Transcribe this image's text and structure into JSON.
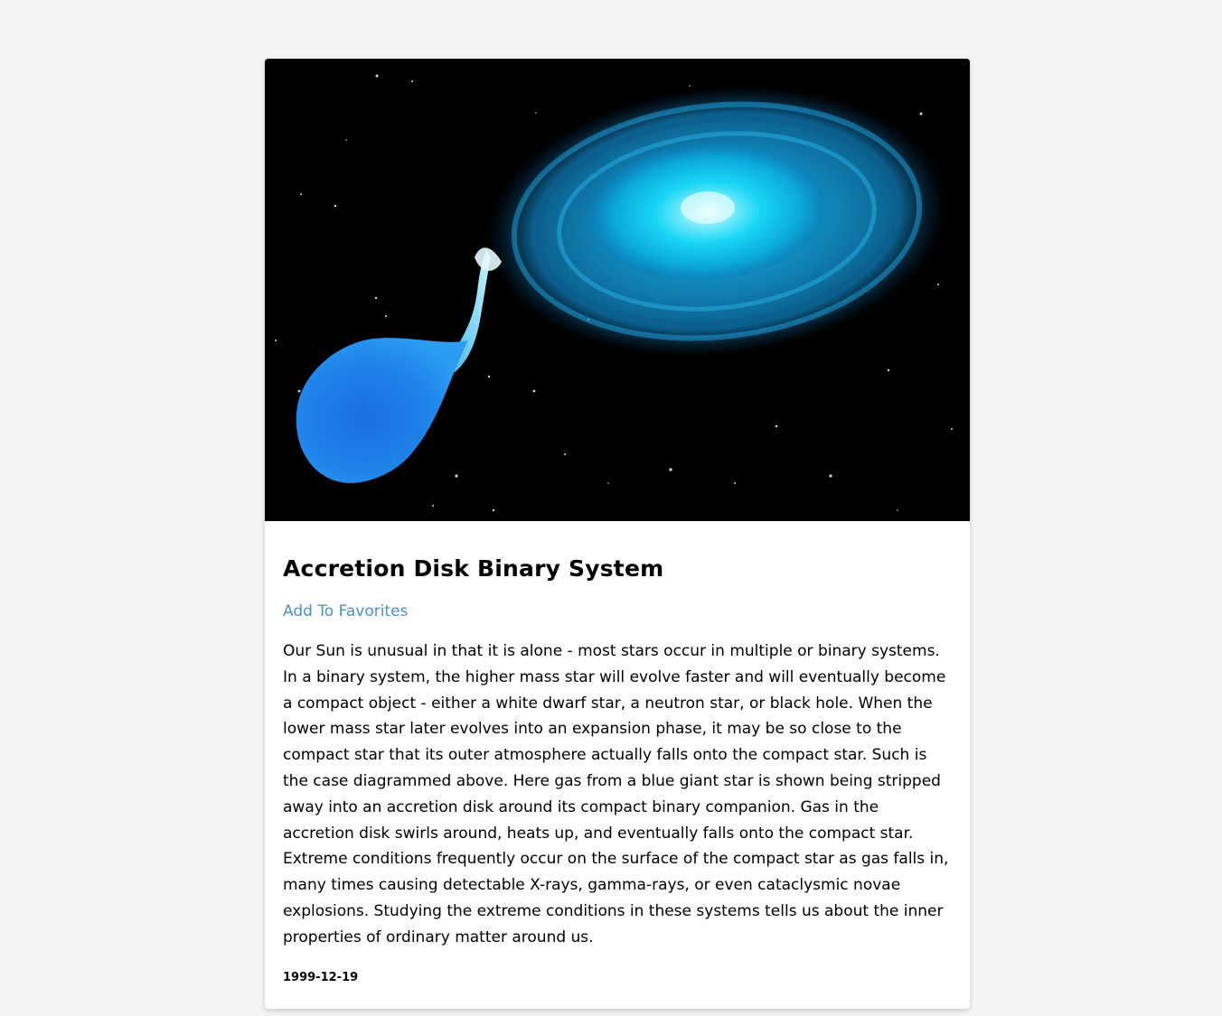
{
  "article": {
    "title": "Accretion Disk Binary System",
    "favorites_label": "Add To Favorites",
    "description": "Our Sun is unusual in that it is alone - most stars occur in multiple or binary systems. In a binary system, the higher mass star will evolve faster and will eventually become a compact object - either a white dwarf star, a neutron star, or black hole. When the lower mass star later evolves into an expansion phase, it may be so close to the compact star that its outer atmosphere actually falls onto the compact star. Such is the case diagrammed above. Here gas from a blue giant star is shown being stripped away into an accretion disk around its compact binary companion. Gas in the accretion disk swirls around, heats up, and eventually falls onto the compact star. Extreme conditions frequently occur on the surface of the compact star as gas falls in, many times causing detectable X-rays, gamma-rays, or even cataclysmic novae explosions. Studying the extreme conditions in these systems tells us about the inner properties of ordinary matter around us.",
    "date": "1999-12-19"
  },
  "colors": {
    "page_background": "#f4f4f4",
    "card_background": "#ffffff",
    "link": "#4a90c2",
    "disk": "#1aa8e6",
    "giant_star": "#1e7fe0"
  }
}
